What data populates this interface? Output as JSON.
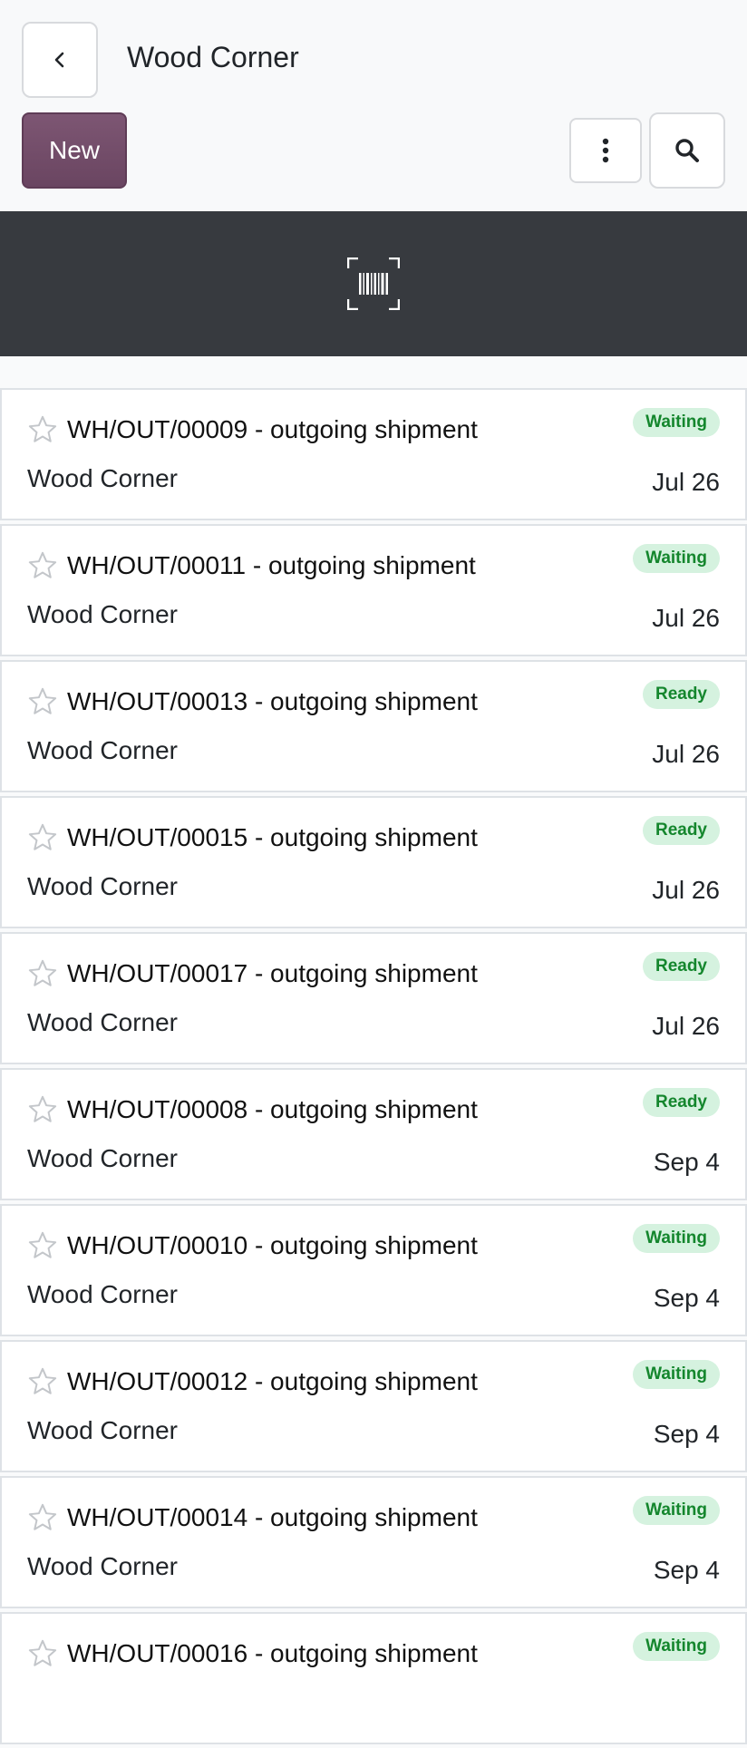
{
  "header": {
    "title": "Wood Corner",
    "new_label": "New"
  },
  "icons": {
    "back": "chevron-left-icon",
    "more": "vertical-ellipsis-icon",
    "search": "search-icon",
    "scan": "barcode-scan-icon",
    "favorite": "star-outline-icon"
  },
  "colors": {
    "primary": "#714b67",
    "banner": "#373a3f",
    "badge_bg": "#d5f2df",
    "badge_text": "#14862d"
  },
  "transfers": [
    {
      "title": "WH/OUT/00009 - outgoing shipment",
      "partner": "Wood Corner",
      "date": "Jul 26",
      "status": "Waiting"
    },
    {
      "title": "WH/OUT/00011 - outgoing shipment",
      "partner": "Wood Corner",
      "date": "Jul 26",
      "status": "Waiting"
    },
    {
      "title": "WH/OUT/00013 - outgoing shipment",
      "partner": "Wood Corner",
      "date": "Jul 26",
      "status": "Ready"
    },
    {
      "title": "WH/OUT/00015 - outgoing shipment",
      "partner": "Wood Corner",
      "date": "Jul 26",
      "status": "Ready"
    },
    {
      "title": "WH/OUT/00017 - outgoing shipment",
      "partner": "Wood Corner",
      "date": "Jul 26",
      "status": "Ready"
    },
    {
      "title": "WH/OUT/00008 - outgoing shipment",
      "partner": "Wood Corner",
      "date": "Sep 4",
      "status": "Ready"
    },
    {
      "title": "WH/OUT/00010 - outgoing shipment",
      "partner": "Wood Corner",
      "date": "Sep 4",
      "status": "Waiting"
    },
    {
      "title": "WH/OUT/00012 - outgoing shipment",
      "partner": "Wood Corner",
      "date": "Sep 4",
      "status": "Waiting"
    },
    {
      "title": "WH/OUT/00014 - outgoing shipment",
      "partner": "Wood Corner",
      "date": "Sep 4",
      "status": "Waiting"
    },
    {
      "title": "WH/OUT/00016 - outgoing shipment",
      "partner": "",
      "date": "",
      "status": "Waiting"
    }
  ]
}
